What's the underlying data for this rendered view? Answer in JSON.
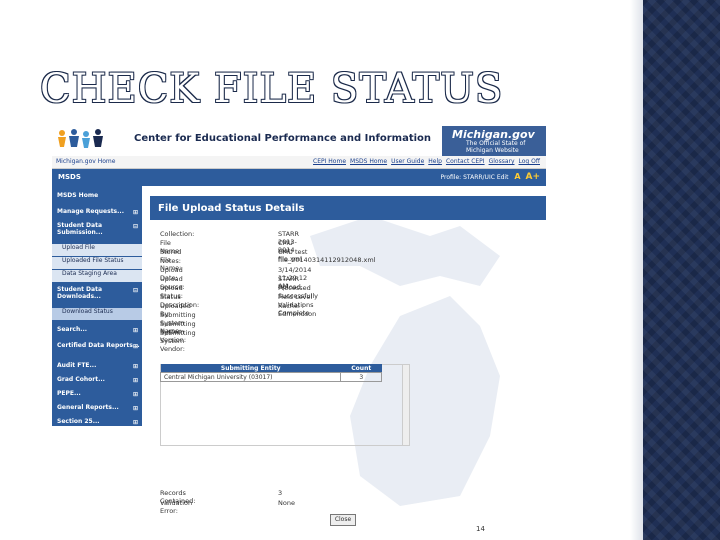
{
  "slide": {
    "title": "CHECK FILE STATUS",
    "page_number": "14"
  },
  "header": {
    "title": "Center for Educational Performance and Information",
    "michigan_logo_title": "Michigan.gov",
    "michigan_logo_subtitle": "The Official State of Michigan Website"
  },
  "topnav": {
    "home": "Michigan.gov Home",
    "links": [
      "CEPI Home",
      "MSDS Home",
      "User Guide",
      "Help",
      "Contact CEPI",
      "Glossary",
      "Log Off"
    ]
  },
  "appbar": {
    "label": "MSDS",
    "profile": "Profile: STARR/UIC Edit",
    "font_a": "A",
    "font_a_plus": "A+"
  },
  "sidebar": {
    "items": [
      {
        "label": "MSDS Home"
      },
      {
        "label": "Manage Requests...",
        "icon": "plus"
      },
      {
        "label": "Student Data Submission...",
        "icon": "minus"
      },
      {
        "label": "Upload File"
      },
      {
        "label": "Uploaded File Status"
      },
      {
        "label": "Data Staging Area"
      },
      {
        "label": "Student Data Downloads...",
        "icon": "minus"
      },
      {
        "label": "Download Status"
      },
      {
        "label": "Search...",
        "icon": "plus"
      },
      {
        "label": "Certified Data Reports...",
        "icon": "plus"
      },
      {
        "label": "Audit FTE...",
        "icon": "plus"
      },
      {
        "label": "Grad Cohort...",
        "icon": "plus"
      },
      {
        "label": "PEPE...",
        "icon": "plus"
      },
      {
        "label": "General Reports...",
        "icon": "plus"
      },
      {
        "label": "Section 25...",
        "icon": "plus"
      }
    ]
  },
  "panel": {
    "title": "File Upload Status Details",
    "fields": [
      {
        "label": "Collection:",
        "value": "STARR 2013-2014"
      },
      {
        "label": "File Name:",
        "value": "CMU test file.xml"
      },
      {
        "label": "Stored File Name:",
        "value": "CMU test file_20140314112912048.xml"
      },
      {
        "label": "Notes:",
        "value": ""
      },
      {
        "label": "Upload Date:",
        "value": "3/14/2014 11:29:12 AM"
      },
      {
        "label": "Upload Source:",
        "value": "STARR Upload"
      },
      {
        "label": "Upload Status:",
        "value": "Processed Successfully"
      },
      {
        "label": "Status Description:",
        "value": "Field Level Validations Complete"
      },
      {
        "label": "Uploaded By:",
        "value": "Rachel I Edmondson"
      },
      {
        "label": "Submitting System Name:",
        "value": ""
      },
      {
        "label": "Submitting System Version:",
        "value": ""
      },
      {
        "label": "Submitting System Vendor:",
        "value": ""
      }
    ],
    "table": {
      "headers": [
        "Submitting Entity",
        "Count"
      ],
      "rows": [
        [
          "Central Michigan University (03017)",
          "3"
        ]
      ]
    },
    "records_contained": {
      "label": "Records Contained:",
      "value": "3"
    },
    "validation_error": {
      "label": "Validation Error:",
      "value": "None"
    },
    "close_label": "Close"
  },
  "colors": {
    "brand_blue": "#2d5c9c",
    "dark_band": "#1f2f55",
    "accent_yellow": "#ffcc33"
  }
}
